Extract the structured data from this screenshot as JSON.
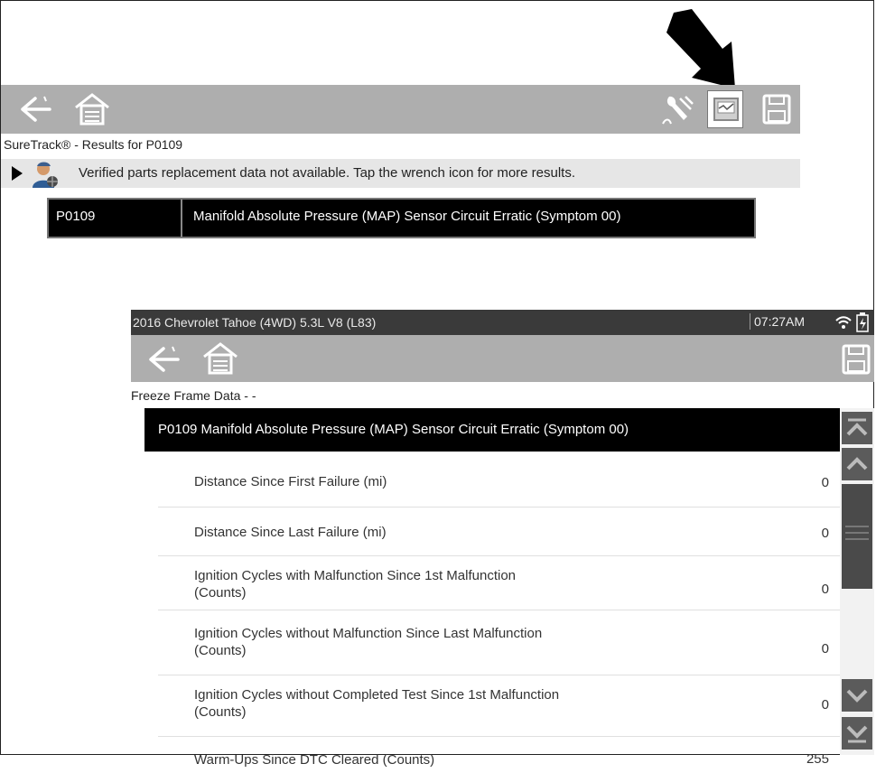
{
  "top_screen": {
    "title": "SureTrack® - Results for P0109",
    "banner_text": "Verified parts replacement data not available. Tap the wrench icon for more results.",
    "dtc_code": "P0109",
    "dtc_description": "Manifold Absolute Pressure (MAP) Sensor Circuit Erratic (Symptom 00)",
    "icons": [
      "back-arrow-icon",
      "home-icon",
      "wrench-icon",
      "freeze-frame-icon",
      "save-icon"
    ]
  },
  "bottom_screen": {
    "vehicle": "2016 Chevrolet Tahoe (4WD) 5.3L V8 (L83)",
    "time": "07:27AM",
    "title": "Freeze Frame Data - -",
    "header": "P0109 Manifold Absolute Pressure (MAP) Sensor Circuit Erratic (Symptom 00)",
    "rows": [
      {
        "label_line1": "Distance Since First Failure (mi)",
        "label_line2": "",
        "value": "0"
      },
      {
        "label_line1": "Distance Since Last Failure (mi)",
        "label_line2": "",
        "value": "0"
      },
      {
        "label_line1": "Ignition Cycles with Malfunction Since 1st Malfunction",
        "label_line2": "(Counts)",
        "value": "0"
      },
      {
        "label_line1": "Ignition Cycles without Malfunction Since Last Malfunction",
        "label_line2": "(Counts)",
        "value": "0"
      },
      {
        "label_line1": "Ignition Cycles without Completed Test Since 1st Malfunction",
        "label_line2": "(Counts)",
        "value": "0"
      },
      {
        "label_line1": "Warm-Ups Since DTC Cleared (Counts)",
        "label_line2": "",
        "value": "255"
      }
    ]
  },
  "colors": {
    "toolbar": "#aeaeae",
    "status_bar": "#3a3a3a",
    "header_black": "#000000",
    "scroll_button": "#5b5b5b"
  }
}
